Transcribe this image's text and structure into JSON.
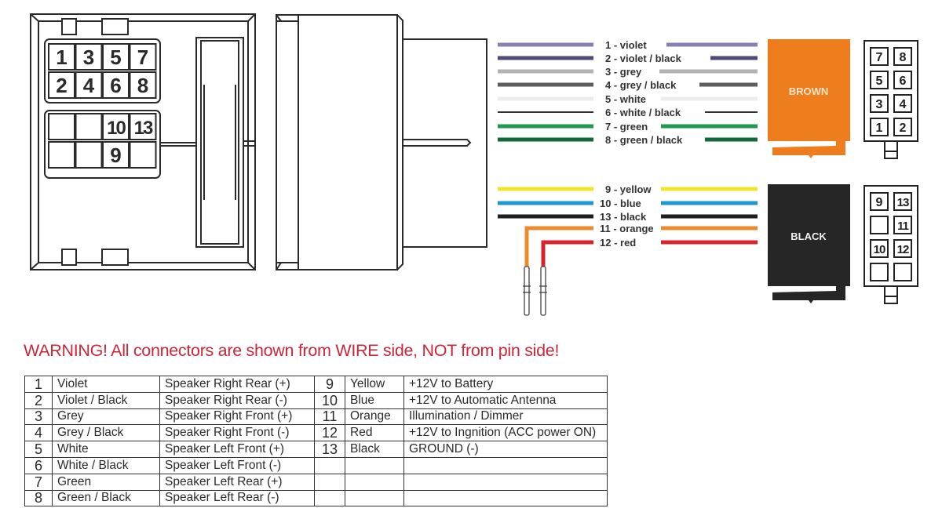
{
  "iso_connector": {
    "pins": [
      {
        "label": "1",
        "col": 0,
        "row": 0
      },
      {
        "label": "3",
        "col": 1,
        "row": 0
      },
      {
        "label": "5",
        "col": 2,
        "row": 0
      },
      {
        "label": "7",
        "col": 3,
        "row": 0
      },
      {
        "label": "2",
        "col": 0,
        "row": 1
      },
      {
        "label": "4",
        "col": 1,
        "row": 1
      },
      {
        "label": "6",
        "col": 2,
        "row": 1
      },
      {
        "label": "8",
        "col": 3,
        "row": 1
      },
      {
        "label": "",
        "col": 0,
        "row": 2
      },
      {
        "label": "",
        "col": 1,
        "row": 2
      },
      {
        "label": "10",
        "col": 2,
        "row": 2
      },
      {
        "label": "13",
        "col": 3,
        "row": 2
      },
      {
        "label": "",
        "col": 0,
        "row": 3
      },
      {
        "label": "",
        "col": 1,
        "row": 3
      },
      {
        "label": "9",
        "col": 2,
        "row": 3
      },
      {
        "label": "",
        "col": 3,
        "row": 3
      }
    ]
  },
  "wires_top": [
    {
      "label": "1 - violet",
      "color": "#8a7fb5"
    },
    {
      "label": "2 - violet / black",
      "color": "#4e4a7c"
    },
    {
      "label": "3 - grey",
      "color": "#b3b3b3"
    },
    {
      "label": "4 - grey / black",
      "color": "#5e5e5e"
    },
    {
      "label": "5 - white",
      "color": "#ececec"
    },
    {
      "label": "6 - white / black",
      "color": "#333333"
    },
    {
      "label": "7 - green",
      "color": "#1e9a50"
    },
    {
      "label": "8 - green / black",
      "color": "#11693a"
    }
  ],
  "wires_bottom": [
    {
      "label": "9 - yellow",
      "color": "#f1e42a"
    },
    {
      "label": "10 - blue",
      "color": "#1d9ad6"
    },
    {
      "label": "13 - black",
      "color": "#1e1e1e"
    },
    {
      "label": "11 - orange",
      "color": "#ee8a2e"
    },
    {
      "label": "12 - red",
      "color": "#d7232e"
    }
  ],
  "plug_brown": {
    "label": "BROWN",
    "color": "#ee7d1e",
    "pins": [
      "7",
      "8",
      "5",
      "6",
      "3",
      "4",
      "1",
      "2"
    ]
  },
  "plug_black": {
    "label": "BLACK",
    "color": "#262626",
    "pins": [
      "9",
      "13",
      "",
      "11",
      "10",
      "12",
      "",
      ""
    ]
  },
  "warning": "WARNING! All connectors are shown from WIRE side, NOT from pin side!",
  "table": {
    "rows": [
      {
        "n1": "1",
        "c1": "Violet",
        "f1": "Speaker Right Rear (+)",
        "n2": "9",
        "c2": "Yellow",
        "f2": "+12V to Battery"
      },
      {
        "n1": "2",
        "c1": "Violet / Black",
        "f1": "Speaker Right Rear (-)",
        "n2": "10",
        "c2": "Blue",
        "f2": "+12V to Automatic Antenna"
      },
      {
        "n1": "3",
        "c1": "Grey",
        "f1": "Speaker Right Front (+)",
        "n2": "11",
        "c2": "Orange",
        "f2": "Illumination / Dimmer"
      },
      {
        "n1": "4",
        "c1": "Grey / Black",
        "f1": "Speaker Right Front (-)",
        "n2": "12",
        "c2": "Red",
        "f2": "+12V to Ingnition (ACC power ON)"
      },
      {
        "n1": "5",
        "c1": "White",
        "f1": "Speaker Left Front (+)",
        "n2": "13",
        "c2": "Black",
        "f2": "GROUND (-)"
      },
      {
        "n1": "6",
        "c1": "White / Black",
        "f1": "Speaker Left Front (-)",
        "n2": "",
        "c2": "",
        "f2": ""
      },
      {
        "n1": "7",
        "c1": "Green",
        "f1": "Speaker Left Rear (+)",
        "n2": "",
        "c2": "",
        "f2": ""
      },
      {
        "n1": "8",
        "c1": "Green / Black",
        "f1": "Speaker Left Rear (-)",
        "n2": "",
        "c2": "",
        "f2": ""
      }
    ]
  }
}
